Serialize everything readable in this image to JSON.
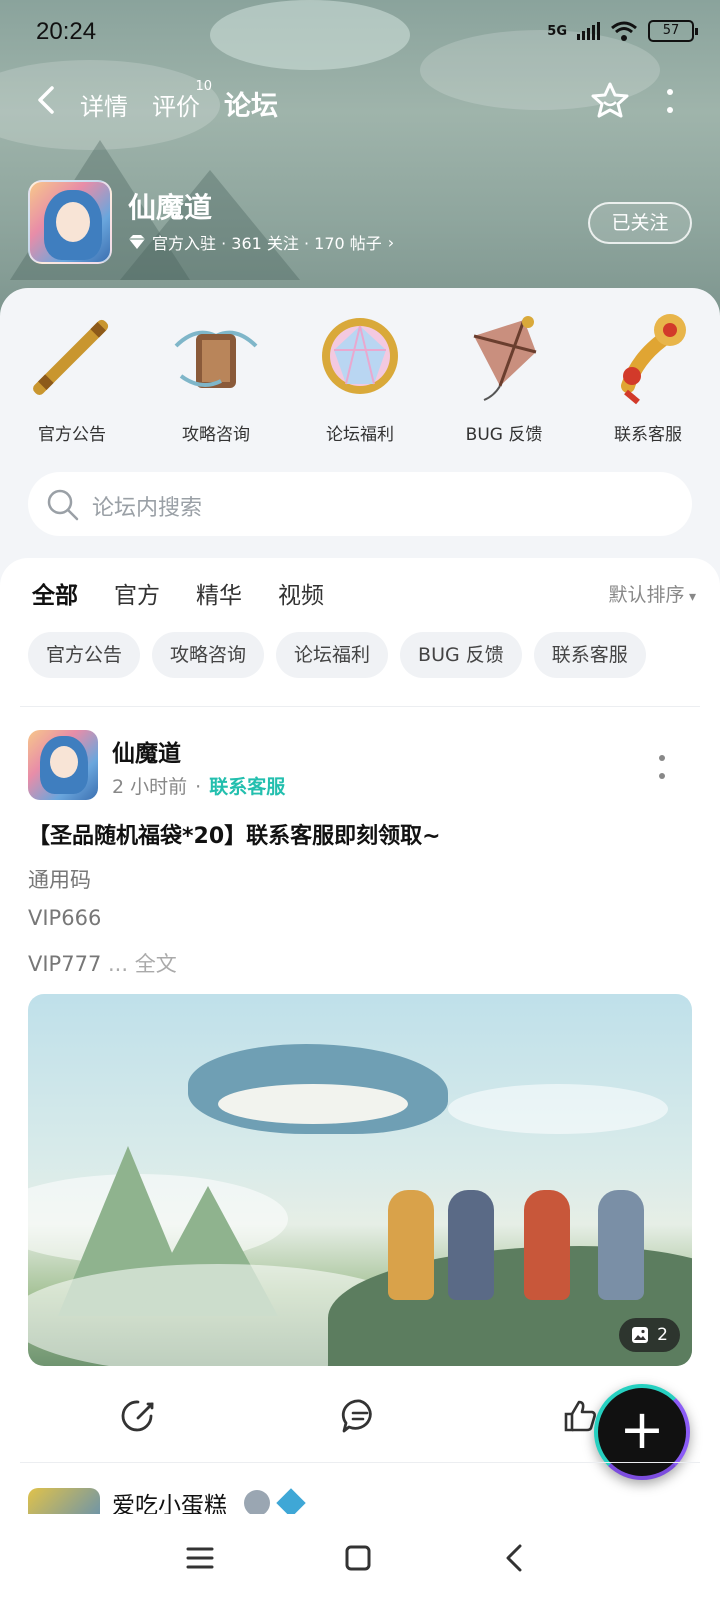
{
  "status_bar": {
    "time": "20:24",
    "network": "5G",
    "battery": "57"
  },
  "top_nav": {
    "tabs": [
      {
        "label": "详情",
        "badge": ""
      },
      {
        "label": "评价",
        "badge": "10"
      },
      {
        "label": "论坛",
        "badge": ""
      }
    ],
    "active_tab": "论坛"
  },
  "game": {
    "name": "仙魔道",
    "meta": "官方入驻 · 361 关注 · 170 帖子",
    "follow_label": "已关注"
  },
  "categories": [
    {
      "label": "官方公告",
      "icon": "scroll-staff-icon"
    },
    {
      "label": "攻略咨询",
      "icon": "book-scroll-icon"
    },
    {
      "label": "论坛福利",
      "icon": "gem-icon"
    },
    {
      "label": "BUG 反馈",
      "icon": "kite-icon"
    },
    {
      "label": "联系客服",
      "icon": "ruyi-scepter-icon"
    }
  ],
  "search": {
    "placeholder": "论坛内搜索"
  },
  "feed_tabs": [
    "全部",
    "官方",
    "精华",
    "视频"
  ],
  "active_feed_tab": "全部",
  "sort_label": "默认排序",
  "chips": [
    "官方公告",
    "攻略咨询",
    "论坛福利",
    "BUG 反馈",
    "联系客服"
  ],
  "post": {
    "author": "仙魔道",
    "time": "2 小时前",
    "tag": "联系客服",
    "title": "【圣品随机福袋*20】联系客服即刻领取~",
    "lines": [
      "通用码",
      "VIP666",
      "VIP777"
    ],
    "more_text": " ... 全文",
    "image_count": "2"
  },
  "next_post": {
    "author": "爱吃小蛋糕"
  },
  "colors": {
    "accent": "#2fd3c2",
    "tag": "#23bfae"
  }
}
